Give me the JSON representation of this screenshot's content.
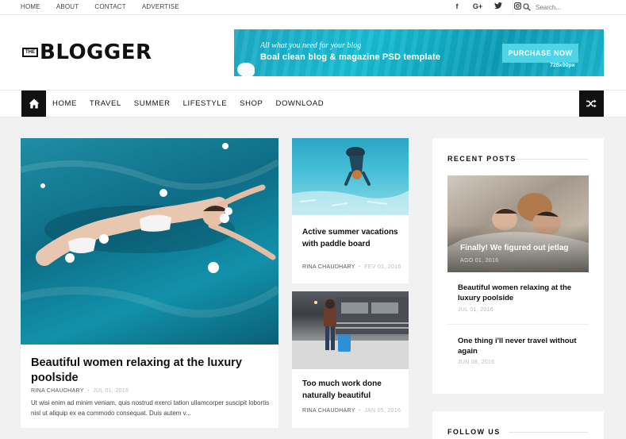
{
  "topbar": {
    "links": [
      "HOME",
      "ABOUT",
      "CONTACT",
      "ADVERTISE"
    ],
    "socials": [
      "facebook-icon",
      "google-plus-icon",
      "twitter-icon",
      "instagram-icon"
    ],
    "search_placeholder": "Search..."
  },
  "logo": {
    "prefix": "THE",
    "name": "BLOGGER"
  },
  "banner": {
    "line1": "All what you need for your blog",
    "line2": "Boal clean blog & magazine PSD template",
    "button": "PURCHASE NOW",
    "size": "728x90px"
  },
  "nav": {
    "items": [
      "HOME",
      "TRAVEL",
      "SUMMER",
      "LIFESTYLE",
      "SHOP",
      "DOWNLOAD"
    ]
  },
  "posts": {
    "featured": {
      "title": "Beautiful women relaxing at the luxury poolside",
      "author": "RINA CHAUDHARY",
      "date": "JUL 01, 2016",
      "excerpt": "Ut wisi enim ad minim veniam, quis nostrud exerci tation ullamcorper suscipit lobortis nisl ut aliquip ex ea commodo consequat. Duis autem v..."
    },
    "second": {
      "title": "Active summer vacations with paddle board",
      "author": "RINA CHAUDHARY",
      "date": "FEV 01, 2016"
    },
    "third": {
      "title": "Too much work done naturally beautiful",
      "author": "RINA CHAUDHARY",
      "date": "JAN 05, 2016"
    }
  },
  "sidebar": {
    "recent_heading": "RECENT POSTS",
    "featured": {
      "title": "Finally! We figured out jetlag",
      "date": "AGO 01, 2016"
    },
    "items": [
      {
        "title": "Beautiful women relaxing at the luxury poolside",
        "date": "JUL 01, 2016"
      },
      {
        "title": "One thing i'll never travel without again",
        "date": "JUN 08, 2016"
      }
    ],
    "follow_heading": "FOLLOW US"
  },
  "colors": {
    "accent": "#111111",
    "banner": "#17b4cc",
    "banner_button": "#4fd3e6"
  }
}
